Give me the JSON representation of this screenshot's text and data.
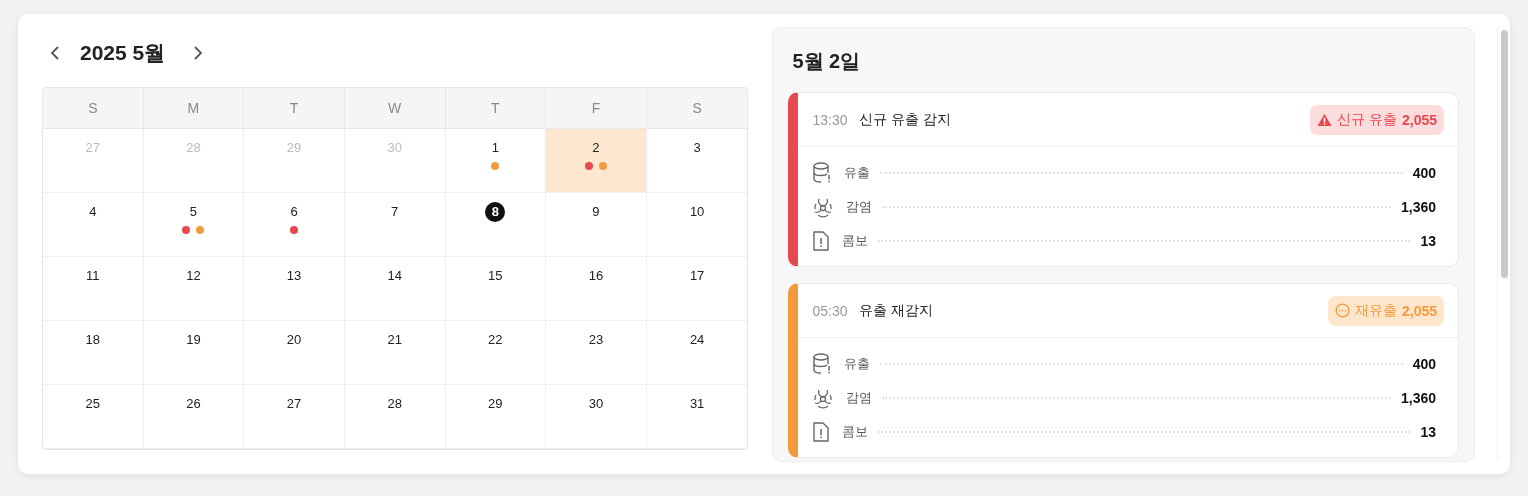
{
  "calendar": {
    "title": "2025 5월",
    "weekdays": [
      "S",
      "M",
      "T",
      "W",
      "T",
      "F",
      "S"
    ],
    "weeks": [
      [
        {
          "day": "27",
          "outside": true,
          "selected": false,
          "today": false
        },
        {
          "day": "28",
          "outside": true,
          "selected": false,
          "today": false
        },
        {
          "day": "29",
          "outside": true,
          "selected": false,
          "today": false
        },
        {
          "day": "30",
          "outside": true,
          "selected": false,
          "today": false
        },
        {
          "day": "1",
          "outside": false,
          "selected": false,
          "today": false,
          "dots": [
            {
              "color": "#f59a3c"
            }
          ]
        },
        {
          "day": "2",
          "outside": false,
          "selected": true,
          "today": false,
          "dots": [
            {
              "color": "#e8484f"
            },
            {
              "color": "#f59a3c"
            }
          ]
        },
        {
          "day": "3",
          "outside": false,
          "selected": false,
          "today": false
        }
      ],
      [
        {
          "day": "4",
          "outside": false,
          "selected": false,
          "today": false
        },
        {
          "day": "5",
          "outside": false,
          "selected": false,
          "today": false,
          "dots": [
            {
              "color": "#e8484f"
            },
            {
              "color": "#f59a3c"
            }
          ]
        },
        {
          "day": "6",
          "outside": false,
          "selected": false,
          "today": false,
          "dots": [
            {
              "color": "#e8484f"
            }
          ]
        },
        {
          "day": "7",
          "outside": false,
          "selected": false,
          "today": false
        },
        {
          "day": "8",
          "outside": false,
          "selected": false,
          "today": true
        },
        {
          "day": "9",
          "outside": false,
          "selected": false,
          "today": false
        },
        {
          "day": "10",
          "outside": false,
          "selected": false,
          "today": false
        }
      ],
      [
        {
          "day": "11",
          "outside": false,
          "selected": false,
          "today": false
        },
        {
          "day": "12",
          "outside": false,
          "selected": false,
          "today": false
        },
        {
          "day": "13",
          "outside": false,
          "selected": false,
          "today": false
        },
        {
          "day": "14",
          "outside": false,
          "selected": false,
          "today": false
        },
        {
          "day": "15",
          "outside": false,
          "selected": false,
          "today": false
        },
        {
          "day": "16",
          "outside": false,
          "selected": false,
          "today": false
        },
        {
          "day": "17",
          "outside": false,
          "selected": false,
          "today": false
        }
      ],
      [
        {
          "day": "18",
          "outside": false,
          "selected": false,
          "today": false
        },
        {
          "day": "19",
          "outside": false,
          "selected": false,
          "today": false
        },
        {
          "day": "20",
          "outside": false,
          "selected": false,
          "today": false
        },
        {
          "day": "21",
          "outside": false,
          "selected": false,
          "today": false
        },
        {
          "day": "22",
          "outside": false,
          "selected": false,
          "today": false
        },
        {
          "day": "23",
          "outside": false,
          "selected": false,
          "today": false
        },
        {
          "day": "24",
          "outside": false,
          "selected": false,
          "today": false
        }
      ],
      [
        {
          "day": "25",
          "outside": false,
          "selected": false,
          "today": false
        },
        {
          "day": "26",
          "outside": false,
          "selected": false,
          "today": false
        },
        {
          "day": "27",
          "outside": false,
          "selected": false,
          "today": false
        },
        {
          "day": "28",
          "outside": false,
          "selected": false,
          "today": false
        },
        {
          "day": "29",
          "outside": false,
          "selected": false,
          "today": false
        },
        {
          "day": "30",
          "outside": false,
          "selected": false,
          "today": false
        },
        {
          "day": "31",
          "outside": false,
          "selected": false,
          "today": false
        }
      ]
    ]
  },
  "detail": {
    "title": "5월 2일",
    "events": [
      {
        "kind": "new",
        "time": "13:30",
        "title": "신규 유출 감지",
        "badge_label": "신규 유출",
        "badge_count": "2,055",
        "metrics": [
          {
            "kind": "leak",
            "label": "유출",
            "value": "400"
          },
          {
            "kind": "infection",
            "label": "감염",
            "value": "1,360"
          },
          {
            "kind": "combo",
            "label": "콤보",
            "value": "13"
          }
        ]
      },
      {
        "kind": "repeat",
        "time": "05:30",
        "title": "유출 재감지",
        "badge_label": "재유출",
        "badge_count": "2,055",
        "metrics": [
          {
            "kind": "leak",
            "label": "유출",
            "value": "400"
          },
          {
            "kind": "infection",
            "label": "감염",
            "value": "1,360"
          },
          {
            "kind": "combo",
            "label": "콤보",
            "value": "13"
          }
        ]
      }
    ]
  }
}
